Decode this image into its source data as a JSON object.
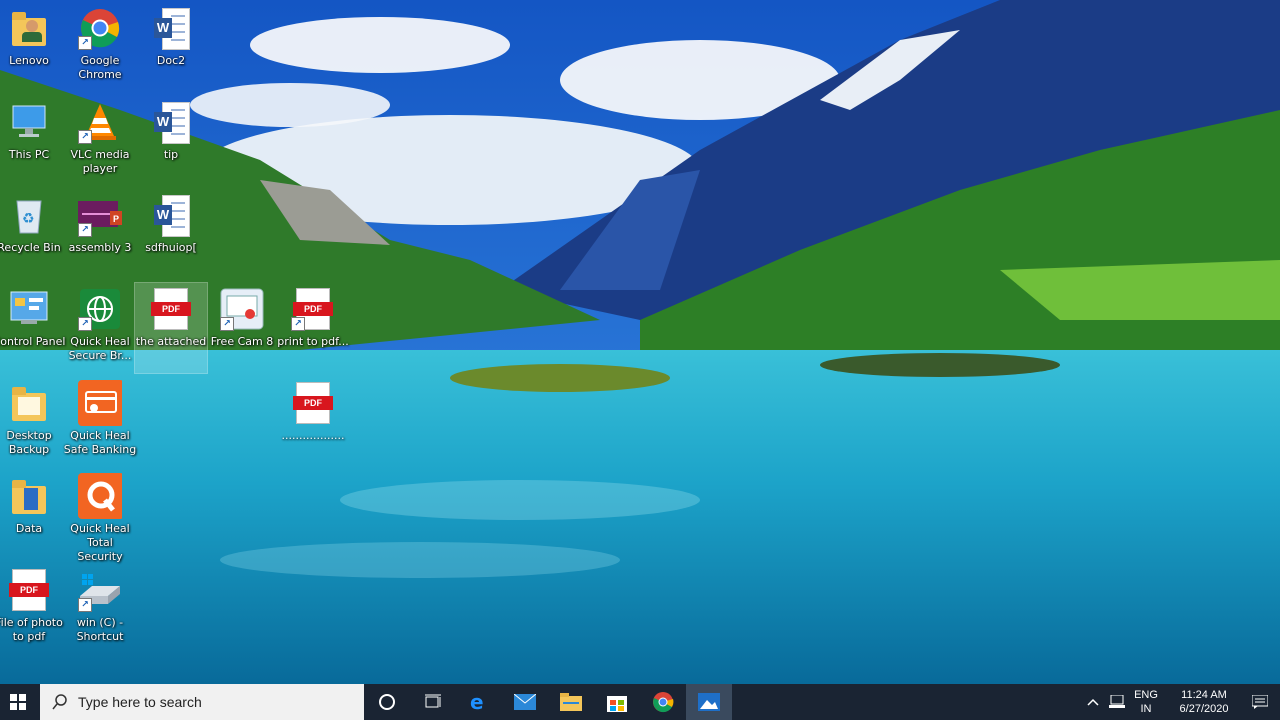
{
  "desktop": {
    "icons": [
      {
        "label": "Lenovo",
        "type": "folder-user"
      },
      {
        "label": "Google Chrome",
        "type": "chrome"
      },
      {
        "label": "Doc2",
        "type": "word"
      },
      {
        "label": "This PC",
        "type": "pc"
      },
      {
        "label": "VLC media player",
        "type": "vlc"
      },
      {
        "label": "tip",
        "type": "word"
      },
      {
        "label": "Recycle Bin",
        "type": "recycle"
      },
      {
        "label": "assembly 3",
        "type": "ppt"
      },
      {
        "label": "sdfhuiop[",
        "type": "word"
      },
      {
        "label": "Control Panel",
        "type": "control"
      },
      {
        "label": "Quick Heal Secure Br...",
        "type": "globe"
      },
      {
        "label": "the attached",
        "type": "pdf"
      },
      {
        "label": "Free Cam 8",
        "type": "freecam"
      },
      {
        "label": "print to pdf...",
        "type": "pdf"
      },
      {
        "label": "Desktop Backup",
        "type": "folder"
      },
      {
        "label": "Quick Heal Safe Banking",
        "type": "safebank"
      },
      {
        "label": "..................",
        "type": "pdf"
      },
      {
        "label": "Data",
        "type": "folder-data"
      },
      {
        "label": "Quick Heal Total Security",
        "type": "qh"
      },
      {
        "label": "File of photo to pdf",
        "type": "pdf"
      },
      {
        "label": "win (C) - Shortcut",
        "type": "drive"
      }
    ],
    "pdf_badge": "PDF",
    "word_badge": "W"
  },
  "taskbar": {
    "search_placeholder": "Type here to search",
    "lang_primary": "ENG",
    "lang_secondary": "IN",
    "time": "11:24 AM",
    "date": "6/27/2020",
    "icons": [
      "windows-start-icon",
      "search-icon",
      "cortana-icon",
      "task-view-icon",
      "edge-icon",
      "mail-icon",
      "file-explorer-icon",
      "store-icon",
      "chrome-icon",
      "photos-icon",
      "tray-chevron-icon",
      "network-icon",
      "notification-icon"
    ]
  },
  "colors": {
    "taskbar": "#1a2433",
    "pdf_red": "#d8161e",
    "word_blue": "#2a5699",
    "qh_orange": "#f26522"
  }
}
